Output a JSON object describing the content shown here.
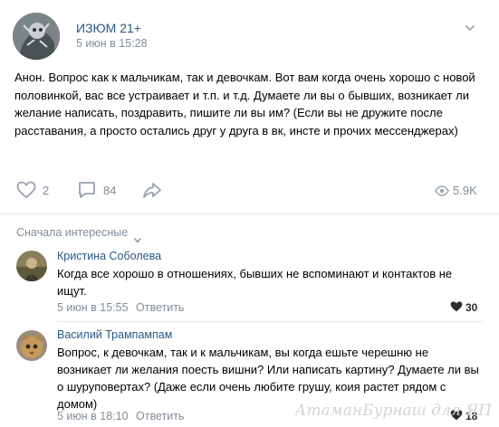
{
  "post": {
    "author": "ИЗЮМ 21+",
    "time": "5 июн в 15:28",
    "text": "Анон. Вопрос как к мальчикам, так и девочкам. Вот вам когда очень хорошо с новой половинкой, вас все устраивает и т.п. и т.д. Думаете ли вы о бывших, возникает ли желание написать, поздравить, пишите ли вы им? (Если вы не дружите после расставания, а просто остались друг у друга в вк, инсте и прочих мессенджерах)",
    "likes": "2",
    "comments": "84",
    "views": "5.9K"
  },
  "comments_section": {
    "sort_label": "Сначала интересные"
  },
  "comments": [
    {
      "author": "Кристина Соболева",
      "text": "Когда все хорошо в отношениях, бывших не вспоминают и контактов не ищут.",
      "time": "5 июн в 15:55",
      "reply": "Ответить",
      "likes": "30"
    },
    {
      "author": "Василий Трампампам",
      "text": "Вопрос, к девочкам, так и к мальчикам, вы когда ешьте черешню не возникает ли желания поесть вишни? Или написать картину? Думаете ли вы о шуруповертах? (Даже если очень любите грушу, коия растет рядом с домом)",
      "time": "5 июн в 18:10",
      "reply": "Ответить",
      "likes": "18"
    }
  ],
  "watermark": "АтаманБурнаш для ЯП",
  "colors": {
    "link": "#2a5885",
    "muted": "#818c99",
    "icon": "#99a2ad",
    "separator": "#e7e8ec"
  },
  "icons": [
    "post-chevron-icon",
    "like-heart-icon",
    "comment-bubble-icon",
    "share-arrow-icon",
    "views-eye-icon",
    "sort-chevron-icon",
    "comment-like-heart-icon"
  ]
}
